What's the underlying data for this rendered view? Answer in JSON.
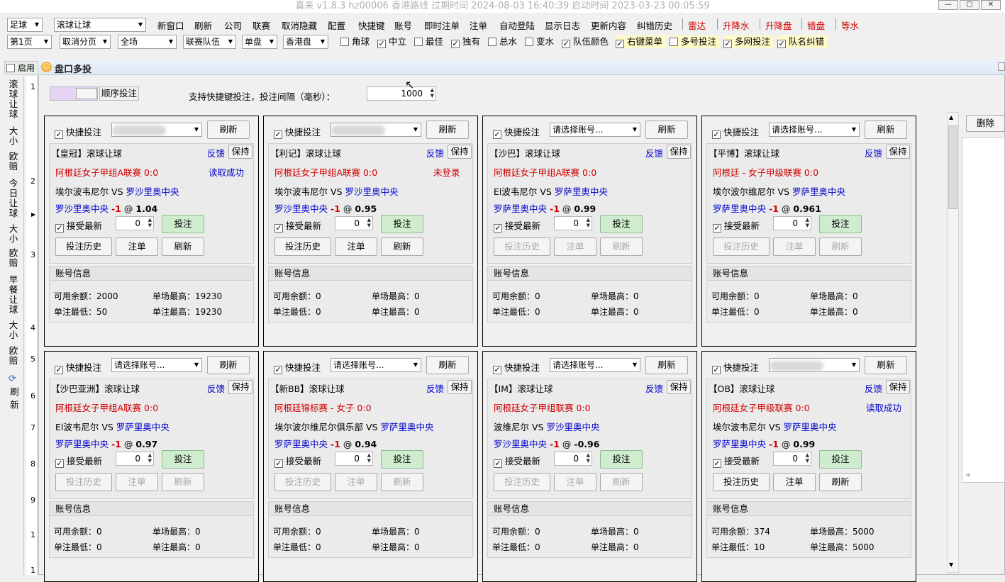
{
  "window": {
    "title": "喜来 v1.8.3 hz00006 香港路线 过期时间 2024-08-03 16:40:39 启动时间 2023-03-23 00:05:59",
    "min": "—",
    "max": "▢",
    "close": "✕"
  },
  "toolbar": {
    "sport": "足球",
    "market": "滚球让球",
    "menus": [
      "新窗口",
      "刷新",
      "公司",
      "联赛",
      "取消隐藏",
      "配置",
      "快捷键",
      "账号",
      "即时注单",
      "注单",
      "自动登陆",
      "显示日志",
      "更新内容",
      "纠错历史"
    ],
    "red_menus": [
      "雷达",
      "升降水",
      "升降盘",
      "错盘",
      "等水"
    ]
  },
  "filters": {
    "page": "第1页",
    "paging": "取消分页",
    "period": "全场",
    "team_filter": "联赛队伍",
    "line": "单盘",
    "odds_type": "香港盘",
    "options": [
      {
        "label": "角球",
        "checked": false,
        "hl": false
      },
      {
        "label": "中立",
        "checked": true,
        "hl": false
      },
      {
        "label": "最佳",
        "checked": false,
        "hl": false
      },
      {
        "label": "独有",
        "checked": true,
        "hl": false
      },
      {
        "label": "总水",
        "checked": false,
        "hl": false
      },
      {
        "label": "变水",
        "checked": false,
        "hl": false
      },
      {
        "label": "队伍颜色",
        "checked": true,
        "hl": false
      },
      {
        "label": "右键菜单",
        "checked": true,
        "hl": true
      },
      {
        "label": "多号投注",
        "checked": false,
        "hl": true
      },
      {
        "label": "多网投注",
        "checked": true,
        "hl": true
      },
      {
        "label": "队名纠错",
        "checked": true,
        "hl": true
      }
    ]
  },
  "sidebar": {
    "enable_label": "启用",
    "tabs": [
      "滚球让球",
      "大小",
      "欧赔",
      "今日让球",
      "大小",
      "欧赔",
      "早餐让球",
      "大小",
      "欧赔"
    ],
    "refresh": "刷新",
    "row_numbers": [
      "1",
      "2",
      "3",
      "4",
      "5",
      "6",
      "7",
      "8",
      "9",
      "1",
      "1",
      "1",
      "1"
    ]
  },
  "dialog": {
    "title": "盘口多投",
    "sequential_label": "顺序投注",
    "interval_label": "支持快捷键投注，投注间隔（毫秒）：",
    "interval_value": "1000",
    "delete_label": "删除"
  },
  "labels": {
    "quick_bet": "快捷投注",
    "refresh": "刷新",
    "feedback": "反馈",
    "keep": "保持",
    "accept_latest": "接受最新",
    "bet": "投注",
    "bet_history": "投注历史",
    "bet_slip": "注单",
    "account_info": "账号信息",
    "available": "可用余额：",
    "max_match": "单场最高：",
    "min_bet": "单注最低：",
    "max_bet": "单注最高：",
    "vs": "VS",
    "at": "@"
  },
  "cards": [
    {
      "account": "",
      "company": "【皇冠】滚球让球",
      "league": "阿根廷女子甲组A联赛 0:0",
      "status": "读取成功",
      "status_color": "#0000cc",
      "home": "埃尔波韦尼尔",
      "away": "罗沙里奥中央",
      "pick": "罗沙里奥中央",
      "hcp": "-1",
      "odds": "1.04",
      "stake": "0",
      "enabled": true,
      "available": "2000",
      "max_match": "19230",
      "min_bet": "50",
      "max_bet": "19230"
    },
    {
      "account": "",
      "company": "【利记】滚球让球",
      "league": "阿根廷女子甲组A联赛 0:0",
      "status": "未登录",
      "status_color": "#d00000",
      "home": "埃尔波韦尼尔",
      "away": "罗沙里奥中央",
      "pick": "罗沙里奥中央",
      "hcp": "-1",
      "odds": "0.95",
      "stake": "0",
      "enabled": true,
      "available": "0",
      "max_match": "0",
      "min_bet": "0",
      "max_bet": "0"
    },
    {
      "account": "请选择账号...",
      "company": "【沙巴】滚球让球",
      "league": "阿根廷女子甲组A联赛 0:0",
      "status": "",
      "status_color": "#0000cc",
      "home": "El波韦尼尔",
      "away": "罗萨里奥中央",
      "pick": "罗萨里奥中央",
      "hcp": "-1",
      "odds": "0.99",
      "stake": "0",
      "enabled": false,
      "available": "0",
      "max_match": "0",
      "min_bet": "0",
      "max_bet": "0"
    },
    {
      "account": "请选择账号...",
      "company": "【平博】滚球让球",
      "league": "阿根廷 - 女子甲级联赛 0:0",
      "status": "",
      "status_color": "#0000cc",
      "home": "埃尔波尔维尼尔",
      "away": "罗萨里奥中央",
      "pick": "罗萨里奥中央",
      "hcp": "-1",
      "odds": "0.961",
      "stake": "0",
      "enabled": false,
      "available": "0",
      "max_match": "0",
      "min_bet": "0",
      "max_bet": "0"
    },
    {
      "account": "请选择账号...",
      "company": "【沙巴亚洲】滚球让球",
      "league": "阿根廷女子甲组A联赛 0:0",
      "status": "",
      "status_color": "#0000cc",
      "home": "El波韦尼尔",
      "away": "罗萨里奥中央",
      "pick": "罗萨里奥中央",
      "hcp": "-1",
      "odds": "0.97",
      "stake": "0",
      "enabled": false,
      "available": "0",
      "max_match": "0",
      "min_bet": "0",
      "max_bet": "0"
    },
    {
      "account": "请选择账号...",
      "company": "【新BB】滚球让球",
      "league": "阿根廷锦标赛 - 女子 0:0",
      "status": "",
      "status_color": "#0000cc",
      "home": "埃尔波尔维尼尔俱乐部",
      "away": "罗萨里奥中央",
      "pick": "罗萨里奥中央",
      "hcp": "-1",
      "odds": "0.94",
      "stake": "0",
      "enabled": false,
      "available": "0",
      "max_match": "0",
      "min_bet": "0",
      "max_bet": "0"
    },
    {
      "account": "请选择账号...",
      "company": "【IM】滚球让球",
      "league": "阿根廷女子甲组联赛 0:0",
      "status": "",
      "status_color": "#0000cc",
      "home": "波维尼尔",
      "away": "罗沙里奥中央",
      "pick": "罗沙里奥中央",
      "hcp": "-1",
      "odds": "-0.96",
      "stake": "0",
      "enabled": false,
      "available": "0",
      "max_match": "0",
      "min_bet": "0",
      "max_bet": "0"
    },
    {
      "account": "",
      "company": "【OB】滚球让球",
      "league": "阿根廷女子甲级联赛 0:0",
      "status": "读取成功",
      "status_color": "#0000cc",
      "home": "埃尔波韦尼尔",
      "away": "罗萨里奥中央",
      "pick": "罗萨里奥中央",
      "hcp": "-1",
      "odds": "0.99",
      "stake": "0",
      "enabled": true,
      "available": "374",
      "max_match": "5000",
      "min_bet": "10",
      "max_bet": "5000"
    }
  ]
}
